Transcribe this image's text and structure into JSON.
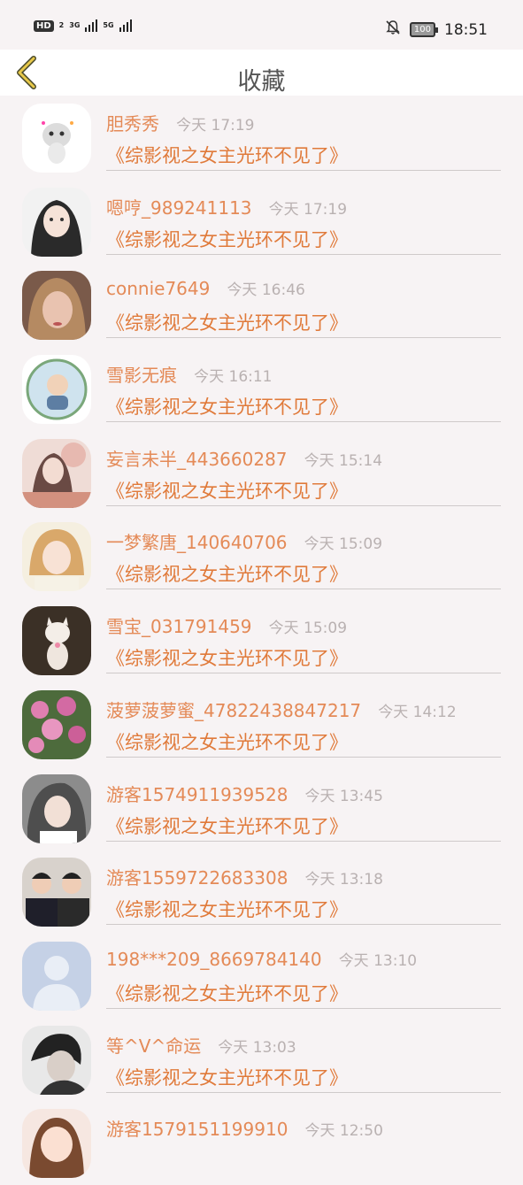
{
  "status_bar": {
    "hd": "HD",
    "hd_sub": "2",
    "net1": "3G",
    "net2": "5G",
    "battery": "100",
    "time": "18:51"
  },
  "header": {
    "title": "收藏",
    "back_icon": "chevron-left-icon"
  },
  "favorites": [
    {
      "user": "胆秀秀",
      "time": "今天 17:19",
      "title": "《综影视之女主光环不见了》"
    },
    {
      "user": "嗯哼_989241113",
      "time": "今天 17:19",
      "title": "《综影视之女主光环不见了》"
    },
    {
      "user": "connie7649",
      "time": "今天 16:46",
      "title": "《综影视之女主光环不见了》"
    },
    {
      "user": "雪影无痕",
      "time": "今天 16:11",
      "title": "《综影视之女主光环不见了》"
    },
    {
      "user": "妄言未半_443660287",
      "time": "今天 15:14",
      "title": "《综影视之女主光环不见了》"
    },
    {
      "user": "一梦繁唐_140640706",
      "time": "今天 15:09",
      "title": "《综影视之女主光环不见了》"
    },
    {
      "user": "雪宝_031791459",
      "time": "今天 15:09",
      "title": "《综影视之女主光环不见了》"
    },
    {
      "user": "菠萝菠萝蜜_47822438847217",
      "time": "今天 14:12",
      "title": "《综影视之女主光环不见了》"
    },
    {
      "user": "游客1574911939528",
      "time": "今天 13:45",
      "title": "《综影视之女主光环不见了》"
    },
    {
      "user": "游客1559722683308",
      "time": "今天 13:18",
      "title": "《综影视之女主光环不见了》"
    },
    {
      "user": "198***209_8669784140",
      "time": "今天 13:10",
      "title": "《综影视之女主光环不见了》"
    },
    {
      "user": "等^V^命运",
      "time": "今天 13:03",
      "title": "《综影视之女主光环不见了》"
    },
    {
      "user": "游客1579151199910",
      "time": "今天 12:50",
      "title": ""
    }
  ],
  "colors": {
    "name": "#e48a57",
    "title": "#e07a3a",
    "time": "#b9b1b1",
    "background": "#f7f3f4"
  }
}
